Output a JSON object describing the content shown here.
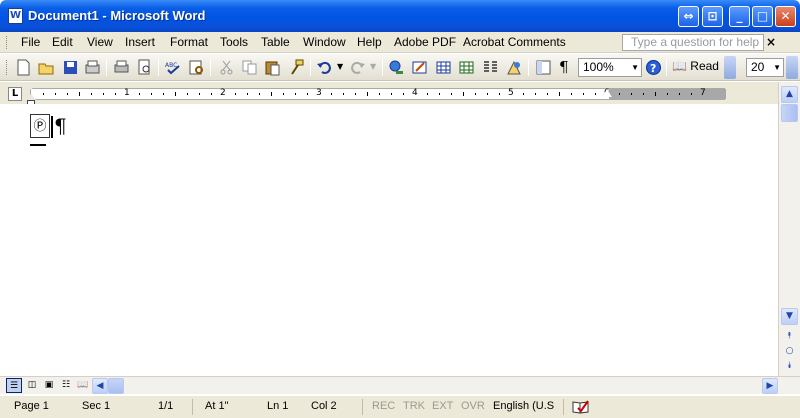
{
  "window": {
    "title": "Document1 - Microsoft Word"
  },
  "menu": {
    "items": [
      "File",
      "Edit",
      "View",
      "Insert",
      "Format",
      "Tools",
      "Table",
      "Window",
      "Help",
      "Adobe PDF",
      "Acrobat Comments"
    ],
    "ask_placeholder": "Type a question for help"
  },
  "toolbar": {
    "zoom": "100%",
    "read_label": "Read",
    "font_size": "20",
    "icons": [
      "new-icon",
      "open-icon",
      "save-icon",
      "permission-icon",
      "print-icon",
      "print-preview-icon",
      "spelling-icon",
      "research-icon",
      "cut-icon",
      "copy-icon",
      "paste-icon",
      "format-painter-icon",
      "undo-icon",
      "redo-icon",
      "hyperlink-icon",
      "tables-borders-icon",
      "insert-table-icon",
      "insert-excel-icon",
      "columns-icon",
      "drawing-icon",
      "document-map-icon",
      "show-hide-icon",
      "help-icon"
    ]
  },
  "ruler": {
    "numbers": [
      "1",
      "2",
      "3",
      "4",
      "5",
      "6",
      "7"
    ],
    "tab_selector": "L"
  },
  "document": {
    "pilcrow": "¶",
    "field_text": "Ⓟ"
  },
  "statusbar": {
    "page": "Page  1",
    "sec": "Sec  1",
    "pages": "1/1",
    "at": "At  1\"",
    "ln": "Ln  1",
    "col": "Col  2",
    "rec": "REC",
    "trk": "TRK",
    "ext": "EXT",
    "ovr": "OVR",
    "language": "English (U.S"
  },
  "colors": {
    "title_bar": "#0054e3",
    "chrome": "#ece9d8",
    "close": "#c8401b"
  }
}
